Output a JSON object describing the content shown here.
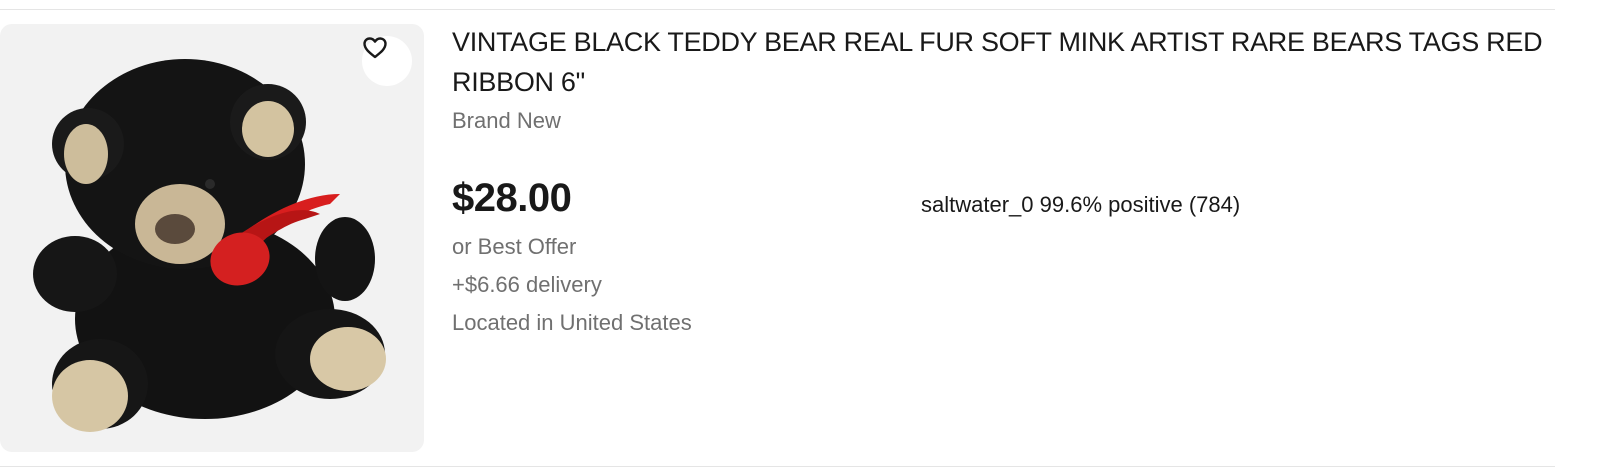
{
  "listing": {
    "title": "VINTAGE BLACK TEDDY BEAR REAL FUR SOFT MINK ARTIST RARE BEARS TAGS RED RIBBON 6\"",
    "condition": "Brand New",
    "price": "$28.00",
    "offer": "or Best Offer",
    "delivery": "+$6.66 delivery",
    "location": "Located in United States",
    "seller": {
      "name": "saltwater_0",
      "rating": "99.6% positive",
      "feedback_count": "(784)"
    },
    "image": {
      "subject": "black-teddy-bear",
      "accent_color": "#d81e1e"
    },
    "favorite_icon": "heart-outline-icon"
  },
  "colors": {
    "price": "#191919",
    "secondary_text": "#707070",
    "image_bg": "#f2f2f2"
  }
}
